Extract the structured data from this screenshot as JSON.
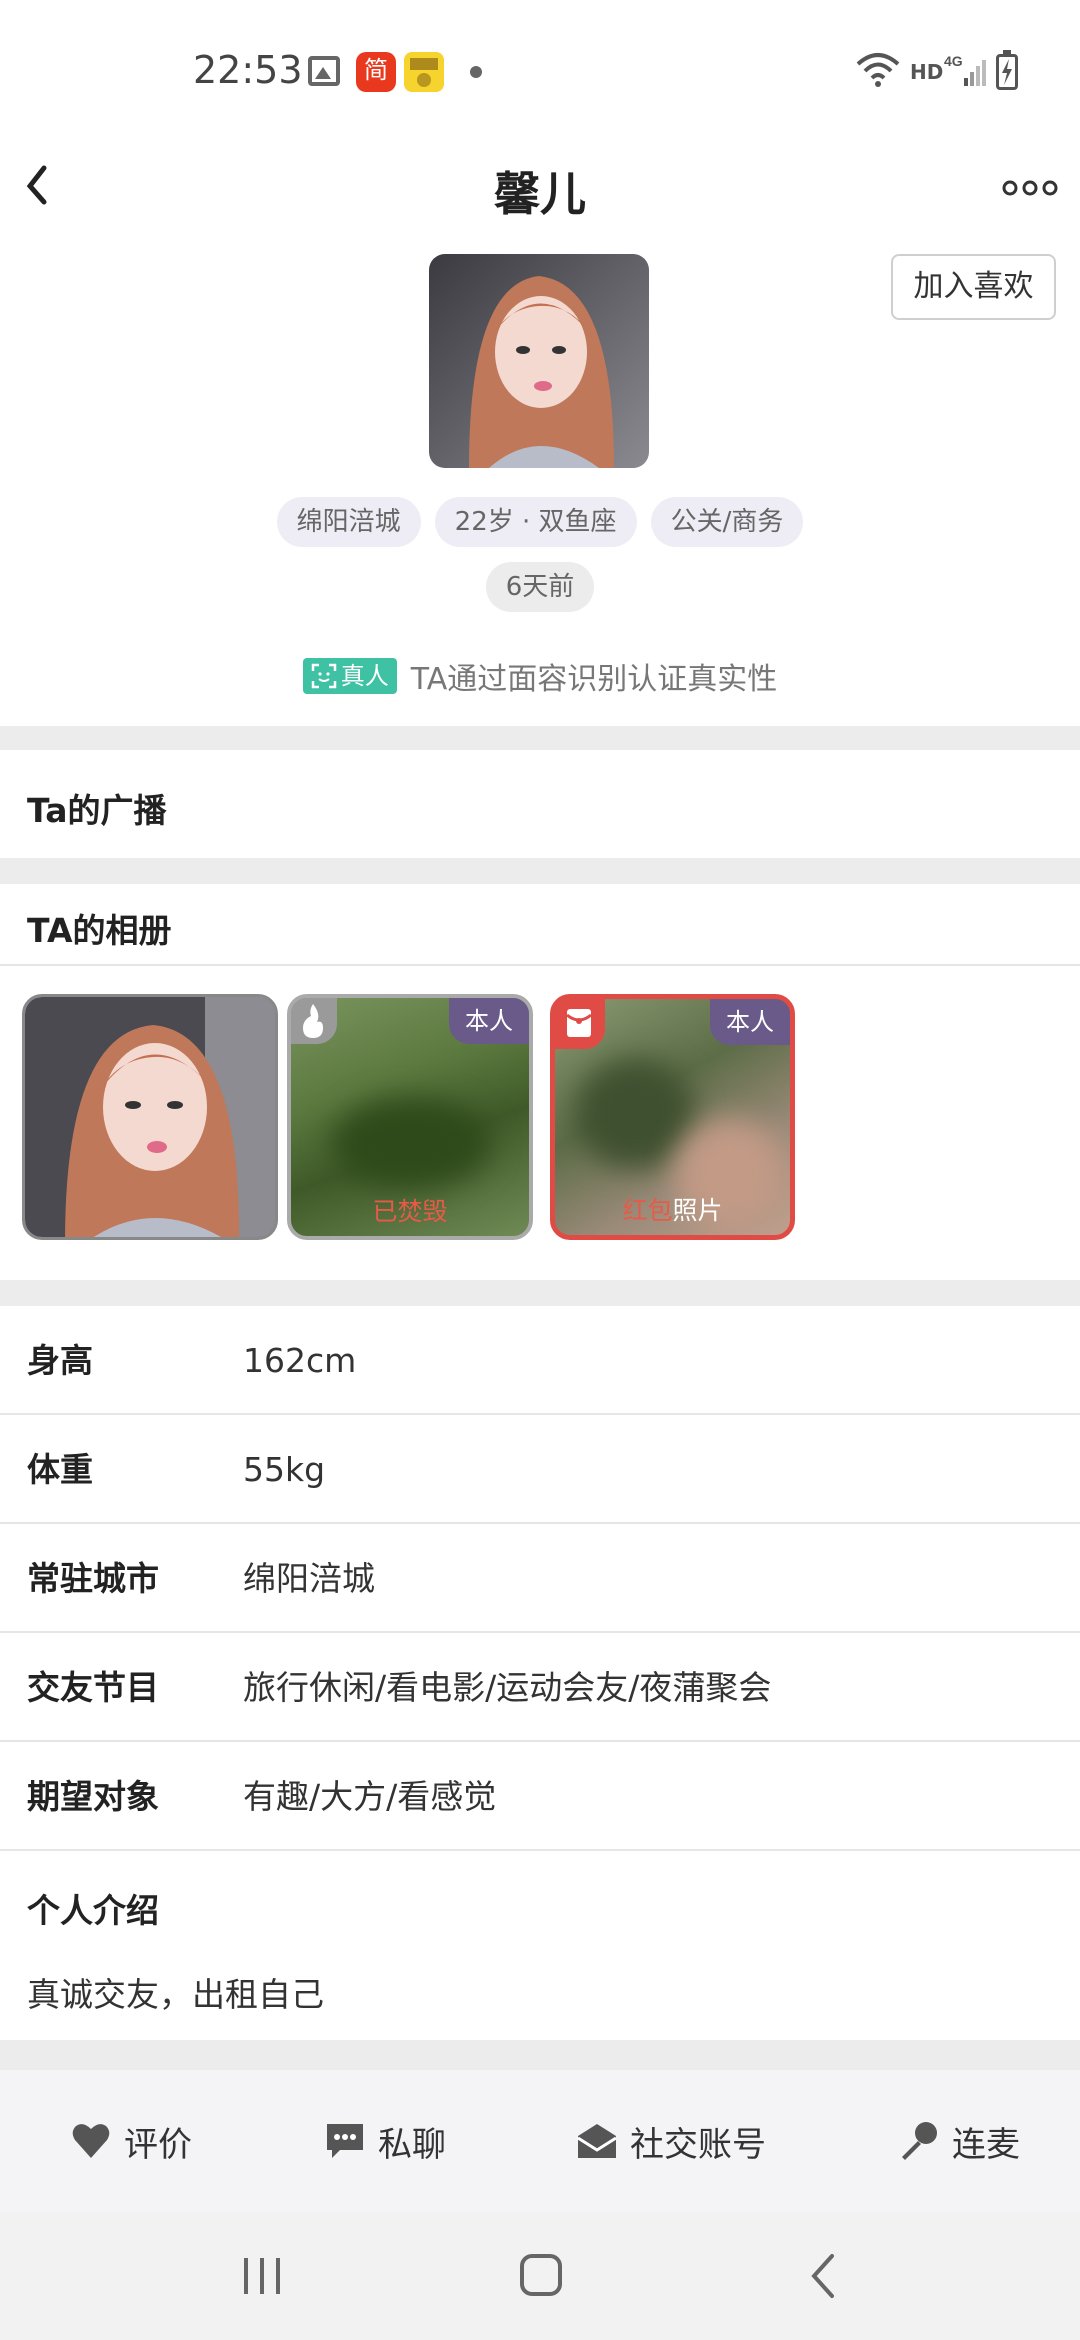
{
  "status_bar": {
    "time": "22:53",
    "app_icon_label": "简",
    "icons": [
      "gallery-icon",
      "jian-app-icon",
      "app-icon",
      "dot-icon",
      "wifi-icon",
      "hd-icon",
      "signal-4g-icon",
      "battery-icon"
    ],
    "hd": "HD",
    "network": "4G"
  },
  "header": {
    "title": "馨儿",
    "back_icon": "back-arrow-icon",
    "more_icon": "more-options-icon"
  },
  "profile": {
    "like_label": "加入喜欢",
    "tags": [
      "绵阳涪城",
      "22岁 · 双鱼座",
      "公关/商务"
    ],
    "last_active": "6天前",
    "verify_badge": "真人",
    "verify_text": "TA通过面容识别认证真实性"
  },
  "broadcast": {
    "title": "Ta的广播"
  },
  "album": {
    "title": "TA的相册",
    "items": [
      {
        "type": "photo"
      },
      {
        "type": "burned",
        "corner_label": "本人",
        "caption": "已焚毁",
        "icon": "flame-icon"
      },
      {
        "type": "red-packet",
        "corner_label": "本人",
        "caption_red": "红包",
        "caption_white": "照片",
        "icon": "red-packet-icon"
      }
    ]
  },
  "info": {
    "rows": [
      {
        "label": "身高",
        "value": "162cm"
      },
      {
        "label": "体重",
        "value": "55kg"
      },
      {
        "label": "常驻城市",
        "value": "绵阳涪城"
      },
      {
        "label": "交友节目",
        "value": "旅行休闲/看电影/运动会友/夜蒲聚会"
      },
      {
        "label": "期望对象",
        "value": "有趣/大方/看感觉"
      }
    ],
    "intro_title": "个人介绍",
    "intro_text": "真诚交友，出租自己"
  },
  "actions": [
    {
      "label": "评价",
      "icon": "heart-icon"
    },
    {
      "label": "私聊",
      "icon": "chat-icon"
    },
    {
      "label": "社交账号",
      "icon": "envelope-icon"
    },
    {
      "label": "连麦",
      "icon": "microphone-icon"
    }
  ],
  "nav": [
    "recent-apps-icon",
    "home-icon",
    "back-icon"
  ],
  "colors": {
    "verify_green": "#3fc1a4",
    "red_accent": "#e04b45",
    "corner_purple": "#6a5a8a",
    "tag_bg": "#eeedf5"
  }
}
